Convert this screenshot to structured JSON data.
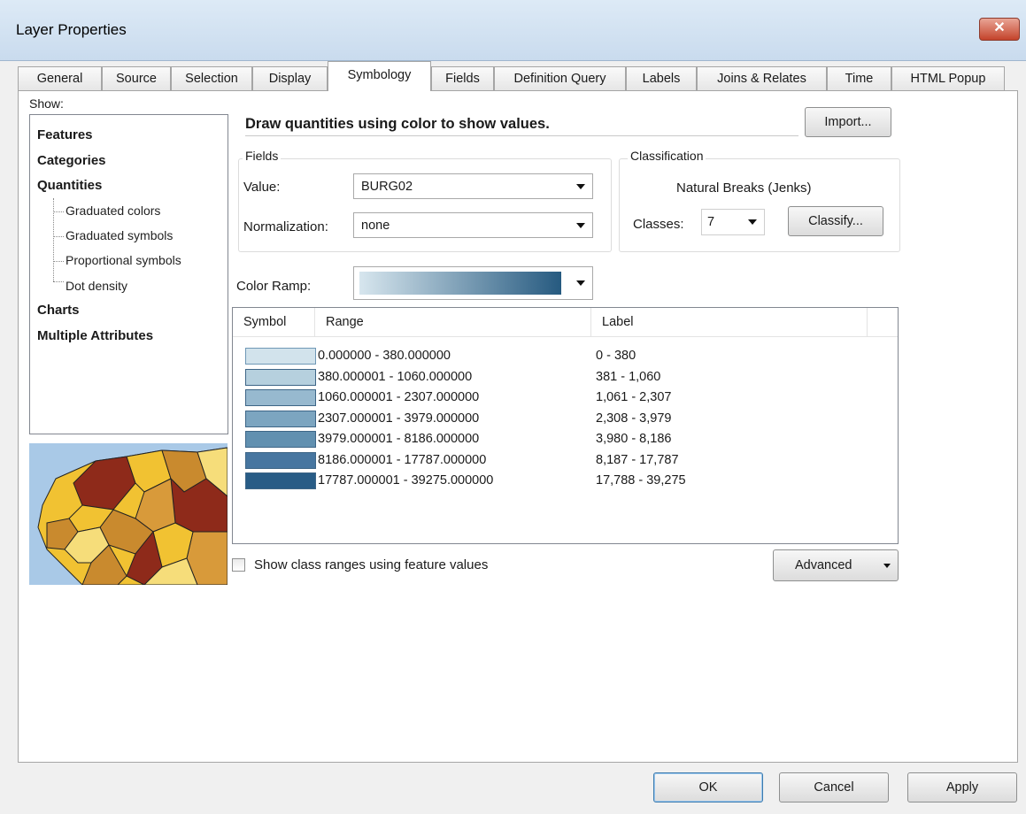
{
  "window": {
    "title": "Layer Properties",
    "close_icon": "close-icon",
    "close_glyph": "✕"
  },
  "tabs": [
    {
      "label": "General"
    },
    {
      "label": "Source"
    },
    {
      "label": "Selection"
    },
    {
      "label": "Display"
    },
    {
      "label": "Symbology",
      "active": true
    },
    {
      "label": "Fields"
    },
    {
      "label": "Definition Query"
    },
    {
      "label": "Labels"
    },
    {
      "label": "Joins & Relates"
    },
    {
      "label": "Time"
    },
    {
      "label": "HTML Popup"
    }
  ],
  "show": {
    "label": "Show:",
    "items": [
      "Features",
      "Categories",
      "Quantities",
      "Graduated colors",
      "Graduated symbols",
      "Proportional symbols",
      "Dot density",
      "Charts",
      "Multiple Attributes"
    ]
  },
  "main": {
    "heading": "Draw quantities using color to show values.",
    "import_label": "Import...",
    "fields_legend": "Fields",
    "value_label": "Value:",
    "value_selected": "BURG02",
    "normalization_label": "Normalization:",
    "normalization_selected": "none",
    "classification_legend": "Classification",
    "classification_method": "Natural Breaks (Jenks)",
    "classes_label": "Classes:",
    "classes_value": "7",
    "classify_label": "Classify...",
    "color_ramp_label": "Color Ramp:",
    "color_ramp_start": "#d7e6ee",
    "color_ramp_end": "#265a80"
  },
  "table": {
    "headers": [
      "Symbol",
      "Range",
      "Label"
    ],
    "rows": [
      {
        "range": "0.000000 - 380.000000",
        "label": "0 - 380",
        "color": "#d2e3ec"
      },
      {
        "range": "380.000001 - 1060.000000",
        "label": "381 - 1,060",
        "color": "#b6d0de"
      },
      {
        "range": "1060.000001 - 2307.000000",
        "label": "1,061 - 2,307",
        "color": "#97b9cf"
      },
      {
        "range": "2307.000001 - 3979.000000",
        "label": "2,308 - 3,979",
        "color": "#7ca5c0"
      },
      {
        "range": "3979.000001 - 8186.000000",
        "label": "3,980 - 8,186",
        "color": "#6190b0"
      },
      {
        "range": "8186.000001 - 17787.000000",
        "label": "8,187 - 17,787",
        "color": "#4776a0"
      },
      {
        "range": "17787.000001 - 39275.000000",
        "label": "17,788 - 39,275",
        "color": "#285c86"
      }
    ]
  },
  "options": {
    "show_class_ranges_label": "Show class ranges using feature values",
    "show_class_ranges_checked": false,
    "advanced_label": "Advanced"
  },
  "footer": {
    "ok_label": "OK",
    "cancel_label": "Cancel",
    "apply_label": "Apply"
  }
}
